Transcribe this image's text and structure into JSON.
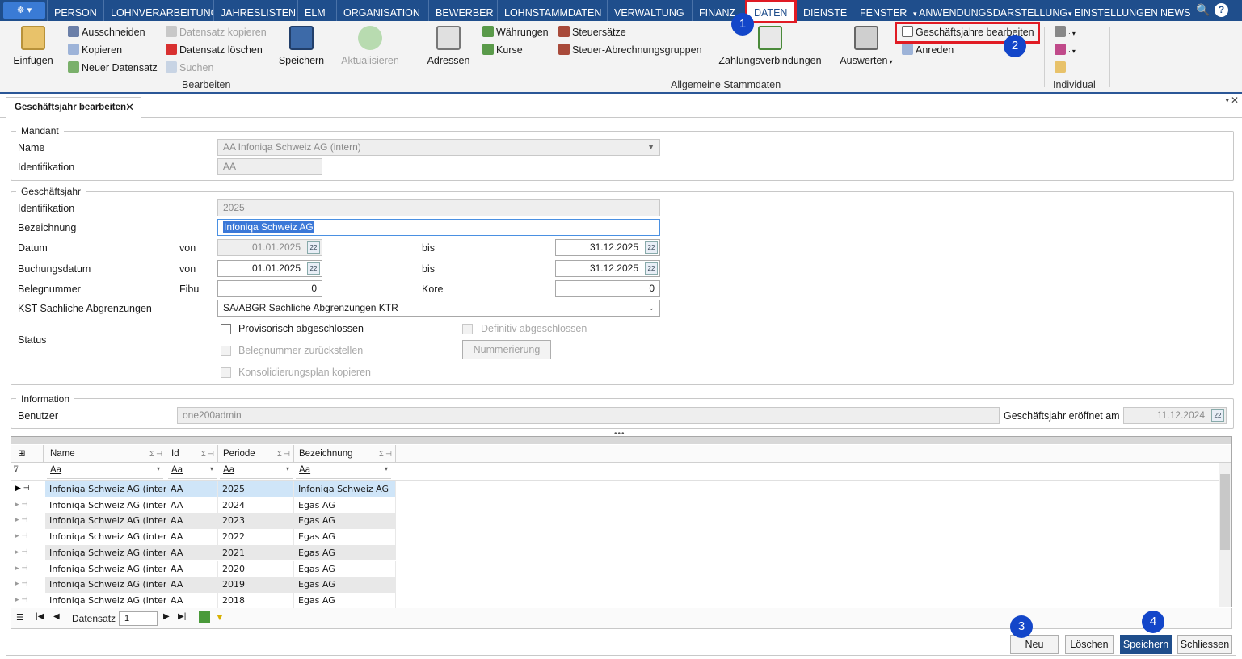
{
  "menubar": {
    "app_glyph": "☸ ▾",
    "items": [
      "PERSON",
      "LOHNVERARBEITUNG",
      "JAHRESLISTEN",
      "ELM",
      "ORGANISATION",
      "BEWERBER",
      "LOHNSTAMMDATEN",
      "VERWALTUNG",
      "FINANZ",
      "DATEN",
      "DIENSTE",
      "FENSTER",
      "ANWENDUNGSDARSTELLUNG",
      "EINSTELLUNGEN",
      "NEWS"
    ],
    "active_index": 9,
    "search_glyph": "🔍",
    "help_glyph": "?"
  },
  "ribbon": {
    "einfuegen": "Einfügen",
    "ausschneiden": "Ausschneiden",
    "kopieren": "Kopieren",
    "neuer_datensatz": "Neuer Datensatz",
    "datensatz_kopieren": "Datensatz kopieren",
    "datensatz_loeschen": "Datensatz löschen",
    "suchen": "Suchen",
    "speichern": "Speichern",
    "aktualisieren": "Aktualisieren",
    "group_bearbeiten": "Bearbeiten",
    "adressen": "Adressen",
    "waehrungen": "Währungen",
    "kurse": "Kurse",
    "steuersaetze": "Steuersätze",
    "steuer_abrechnungsgruppen": "Steuer-Abrechnungsgruppen",
    "zahlungsverbindungen": "Zahlungsverbindungen",
    "auswerten": "Auswerten",
    "geschaeftsjahre_bearbeiten": "Geschäftsjahre bearbeiten",
    "anreden": "Anreden",
    "group_allgemeine": "Allgemeine Stammdaten",
    "group_individual": "Individual"
  },
  "tab": {
    "title": "Geschäftsjahr bearbeiten",
    "close": "✕"
  },
  "mandant": {
    "title": "Mandant",
    "name_label": "Name",
    "name_value": "AA     Infoniqa Schweiz AG (intern)",
    "ident_label": "Identifikation",
    "ident_value": "AA"
  },
  "geschaeftsjahr": {
    "title": "Geschäftsjahr",
    "ident_label": "Identifikation",
    "ident_value": "2025",
    "bez_label": "Bezeichnung",
    "bez_value": "Infoniqa Schweiz AG",
    "datum_label": "Datum",
    "von": "von",
    "bis": "bis",
    "datum_von": "01.01.2025",
    "datum_bis": "31.12.2025",
    "buchung_label": "Buchungsdatum",
    "buchung_von": "01.01.2025",
    "buchung_bis": "31.12.2025",
    "beleg_label": "Belegnummer",
    "fibu": "Fibu",
    "fibu_value": "0",
    "kore": "Kore",
    "kore_value": "0",
    "kst_label": "KST Sachliche Abgrenzungen",
    "kst_value": "SA/ABGR     Sachliche Abgrenzungen     KTR",
    "status_label": "Status",
    "prov": "Provisorisch abgeschlossen",
    "definitiv": "Definitiv abgeschlossen",
    "beleg_zurueck": "Belegnummer zurückstellen",
    "nummerierung": "Nummerierung",
    "konsol": "Konsolidierungsplan kopieren"
  },
  "information": {
    "title": "Information",
    "benutzer_label": "Benutzer",
    "benutzer_value": "one200admin",
    "eroeffnet_label": "Geschäftsjahr eröffnet am",
    "eroeffnet_value": "11.12.2024"
  },
  "grid": {
    "columns": [
      "Name",
      "Id",
      "Periode",
      "Bezeichnung"
    ],
    "filter_placeholder": "Aa",
    "rows": [
      [
        "Infoniqa Schweiz AG (intern)",
        "AA",
        "2025",
        "Infoniqa Schweiz AG"
      ],
      [
        "Infoniqa Schweiz AG (intern)",
        "AA",
        "2024",
        "Egas AG"
      ],
      [
        "Infoniqa Schweiz AG (intern)",
        "AA",
        "2023",
        "Egas AG"
      ],
      [
        "Infoniqa Schweiz AG (intern)",
        "AA",
        "2022",
        "Egas AG"
      ],
      [
        "Infoniqa Schweiz AG (intern)",
        "AA",
        "2021",
        "Egas AG"
      ],
      [
        "Infoniqa Schweiz AG (intern)",
        "AA",
        "2020",
        "Egas AG"
      ],
      [
        "Infoniqa Schweiz AG (intern)",
        "AA",
        "2019",
        "Egas AG"
      ],
      [
        "Infoniqa Schweiz AG (intern)",
        "AA",
        "2018",
        "Egas AG"
      ]
    ]
  },
  "navigator": {
    "datensatz_label": "Datensatz",
    "datensatz_value": "1"
  },
  "footer": {
    "neu": "Neu",
    "loeschen": "Löschen",
    "speichern": "Speichern",
    "schliessen": "Schliessen"
  },
  "callouts": [
    "1",
    "2",
    "3",
    "4"
  ],
  "colors": {
    "menubar": "#1f4e8c",
    "accent": "#1346c9",
    "highlight": "#e01b24"
  }
}
